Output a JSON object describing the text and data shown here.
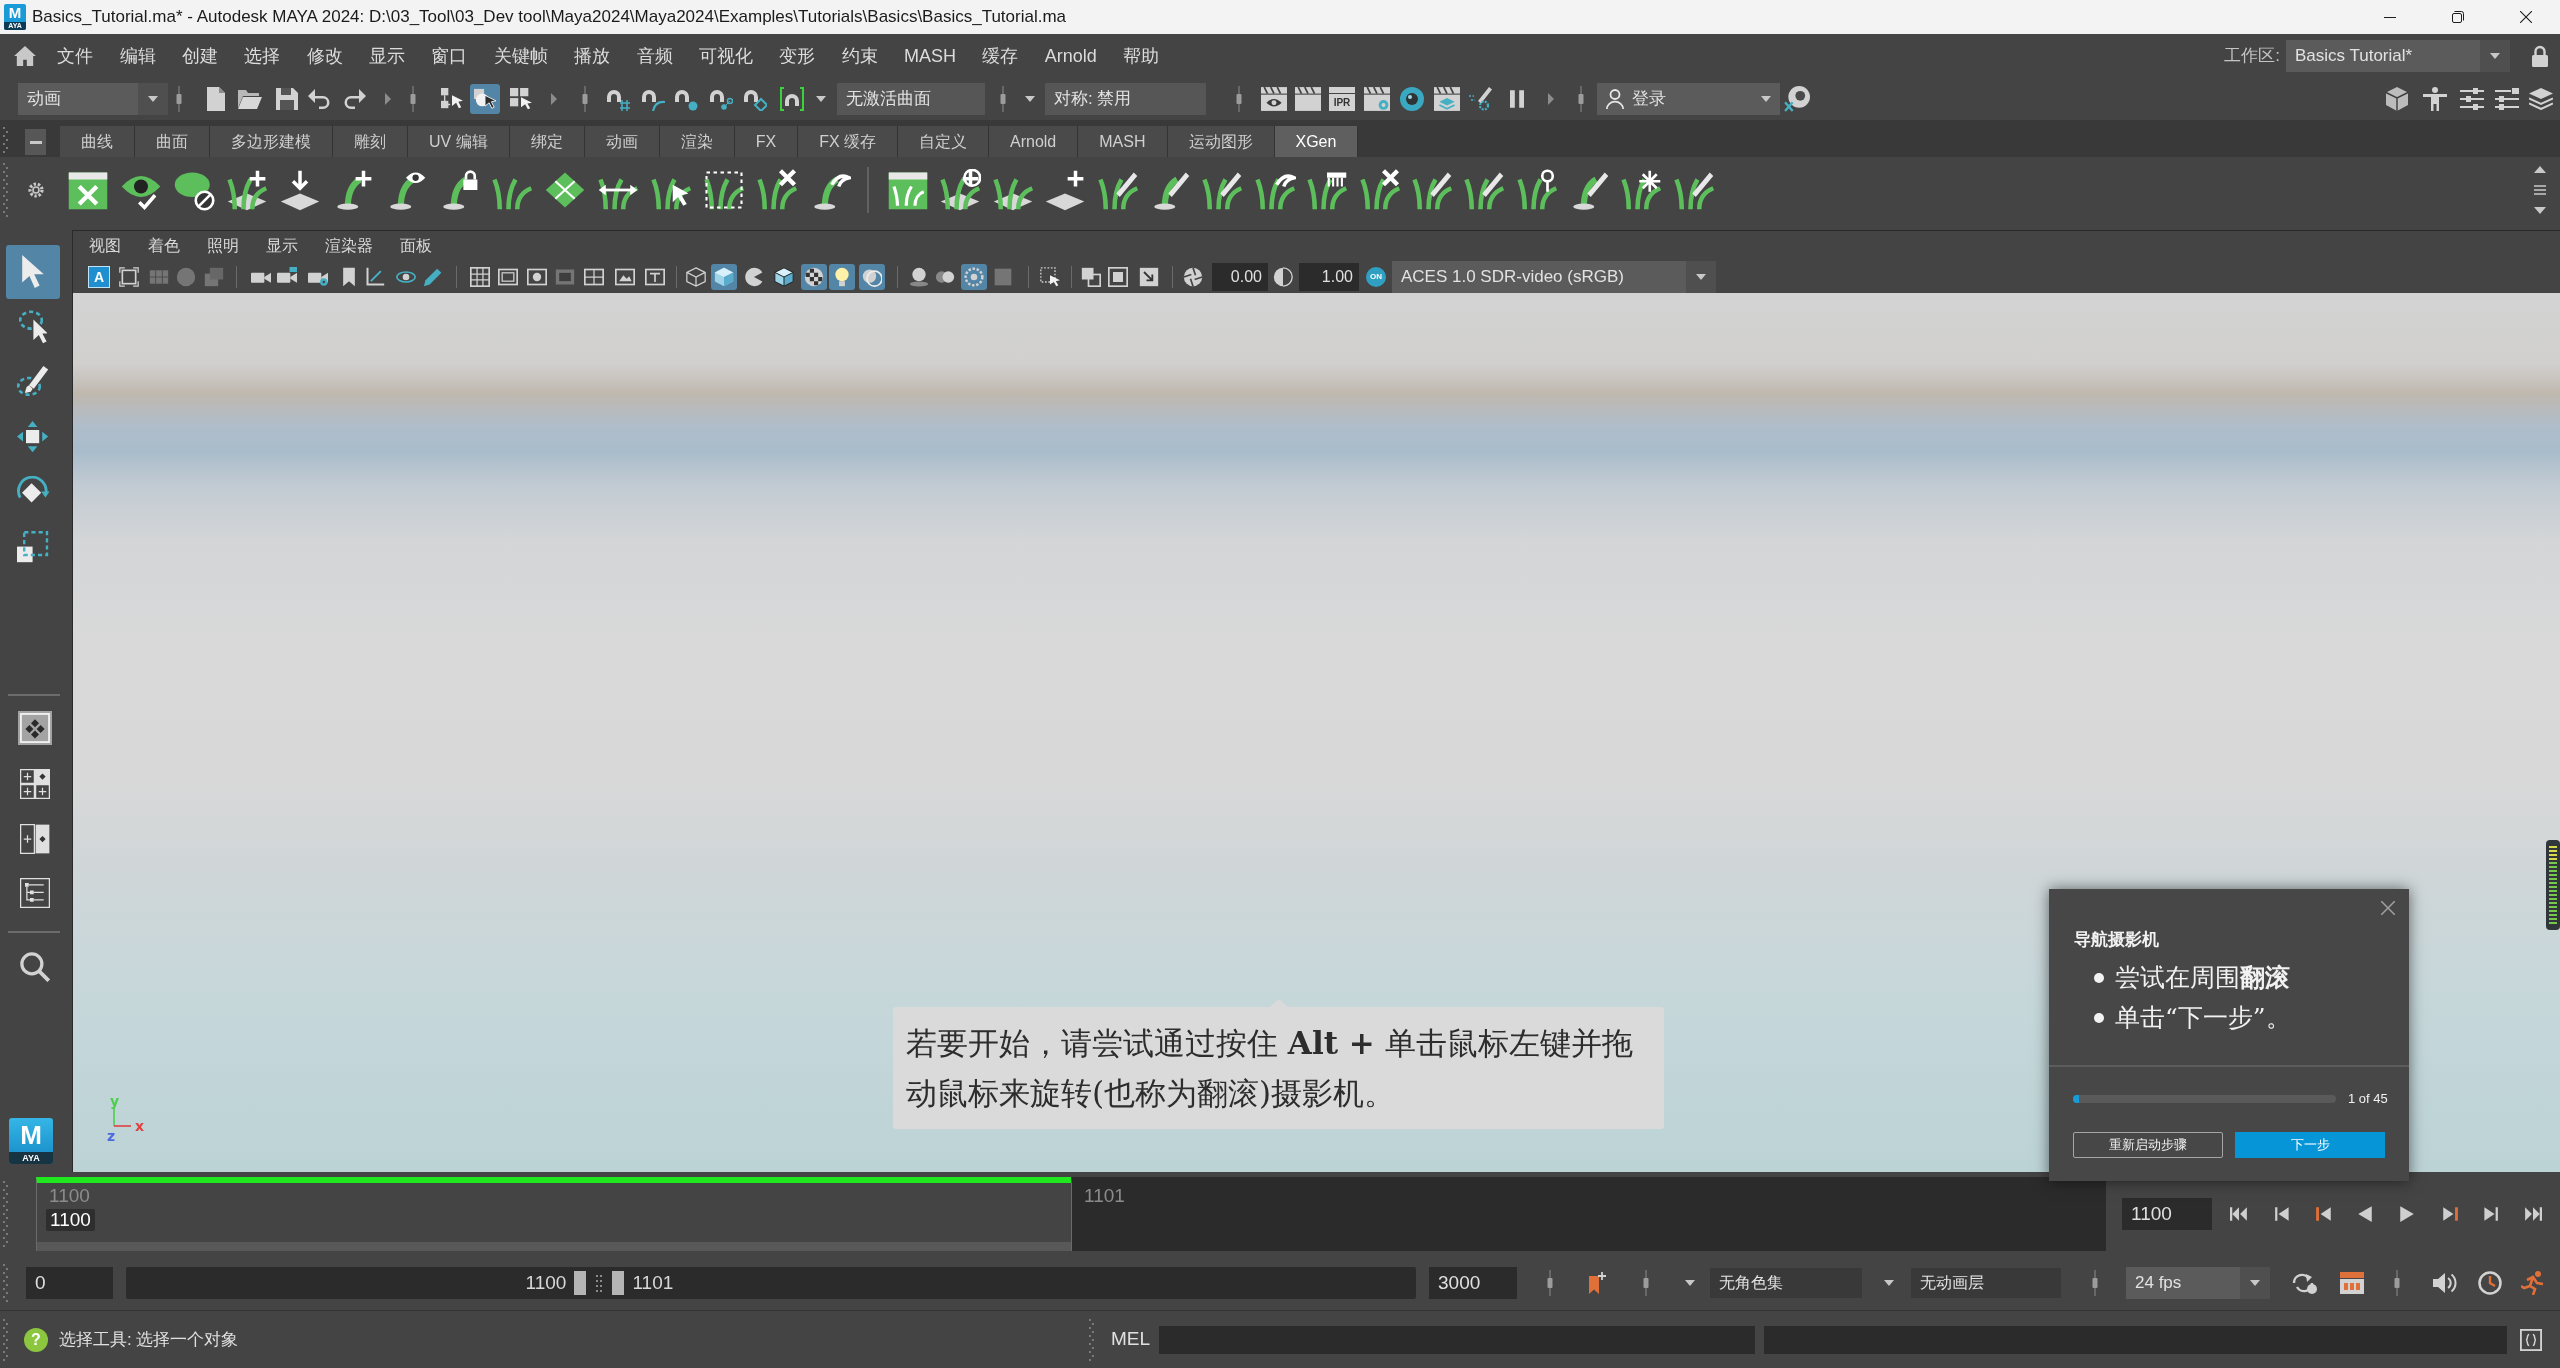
{
  "window": {
    "icon_letter": "M",
    "icon_caption": "AYA",
    "title": "Basics_Tutorial.ma* - Autodesk MAYA 2024: D:\\03_Tool\\03_Dev tool\\Maya2024\\Maya2024\\Examples\\Tutorials\\Basics\\Basics_Tutorial.ma"
  },
  "menu_bar": {
    "items": [
      "文件",
      "编辑",
      "创建",
      "选择",
      "修改",
      "显示",
      "窗口",
      "关键帧",
      "播放",
      "音频",
      "可视化",
      "变形",
      "约束",
      "MASH",
      "缓存",
      "Arnold",
      "帮助"
    ],
    "workspace_label": "工作区:",
    "workspace": "Basics Tutorial*"
  },
  "status_line": {
    "menu_set": "动画",
    "selection_modes": [
      {
        "selected": false
      },
      {
        "selected": true
      },
      {
        "selected": false
      }
    ],
    "live_surface": "无激活曲面",
    "symmetry": "对称: 禁用",
    "ipr_label": "IPR",
    "login": "登录"
  },
  "shelf": {
    "tabs": [
      {
        "label": "曲线",
        "selected": false
      },
      {
        "label": "曲面",
        "selected": false
      },
      {
        "label": "多边形建模",
        "selected": false
      },
      {
        "label": "雕刻",
        "selected": false
      },
      {
        "label": "UV 编辑",
        "selected": false
      },
      {
        "label": "绑定",
        "selected": false
      },
      {
        "label": "动画",
        "selected": false
      },
      {
        "label": "渲染",
        "selected": false
      },
      {
        "label": "FX",
        "selected": false
      },
      {
        "label": "FX 缓存",
        "selected": false
      },
      {
        "label": "自定义",
        "selected": false
      },
      {
        "label": "Arnold",
        "selected": false
      },
      {
        "label": "MASH",
        "selected": false
      },
      {
        "label": "运动图形",
        "selected": false
      },
      {
        "label": "XGen",
        "selected": true
      }
    ]
  },
  "toolbox": {
    "tools": [
      {
        "selected": true
      },
      {
        "selected": false
      },
      {
        "selected": false
      },
      {
        "selected": false
      },
      {
        "selected": false
      },
      {
        "selected": false
      }
    ],
    "layouts": [
      {
        "selected": true
      },
      {
        "selected": false
      },
      {
        "selected": false
      },
      {
        "selected": false
      }
    ],
    "logo_letter": "M",
    "logo_caption": "AYA"
  },
  "viewport_panel": {
    "menu": [
      "视图",
      "着色",
      "照明",
      "显示",
      "渲染器",
      "面板"
    ],
    "camera_letter": "A",
    "toggles": [
      {
        "on": true,
        "disabled": false
      },
      {
        "on": false,
        "disabled": false
      },
      {
        "on": false,
        "disabled": true
      },
      {
        "on": false,
        "disabled": true
      },
      {
        "on": false,
        "disabled": true
      },
      {
        "on": false,
        "disabled": false
      },
      {
        "on": false,
        "disabled": false
      },
      {
        "on": false,
        "disabled": false
      },
      {
        "on": false,
        "disabled": false
      },
      {
        "on": false,
        "disabled": false
      },
      {
        "on": false,
        "disabled": false
      },
      {
        "on": false,
        "disabled": false
      },
      {
        "on": false,
        "disabled": false
      },
      {
        "on": false,
        "disabled": false
      },
      {
        "on": false,
        "disabled": false
      },
      {
        "on": false,
        "disabled": true
      },
      {
        "on": false,
        "disabled": false
      },
      {
        "on": false,
        "disabled": false
      },
      {
        "on": false,
        "disabled": false
      },
      {
        "on": false,
        "disabled": false
      },
      {
        "on": true,
        "disabled": false
      },
      {
        "on": false,
        "disabled": false
      },
      {
        "on": false,
        "disabled": false
      },
      {
        "on": true,
        "disabled": false
      },
      {
        "on": true,
        "disabled": false
      },
      {
        "on": true,
        "disabled": false
      },
      {
        "on": false,
        "disabled": false
      },
      {
        "on": false,
        "disabled": false
      },
      {
        "on": true,
        "disabled": false
      },
      {
        "on": false,
        "disabled": true
      },
      {
        "on": false,
        "disabled": false
      },
      {
        "on": false,
        "disabled": false
      },
      {
        "on": false,
        "disabled": false
      },
      {
        "on": false,
        "disabled": false
      },
      {
        "on": false,
        "disabled": false
      },
      {
        "on": false,
        "disabled": false
      }
    ],
    "exposure": "0.00",
    "gamma": "1.00",
    "view_transform_badge": "ON",
    "view_transform": "ACES 1.0 SDR-video (sRGB)"
  },
  "viewport": {
    "hint": "若要开始，请尝试通过按住 **Alt +** 单击鼠标左键并拖动鼠标来旋转(也称为翻滚)摄影机。",
    "axes": [
      {
        "label": "y",
        "color": "#4ad04a"
      },
      {
        "label": "x",
        "color": "#e04040"
      },
      {
        "label": "z",
        "color": "#4a6ae0"
      }
    ]
  },
  "tutorial": {
    "title": "导航摄影机",
    "steps": [
      "尝试在周围**翻滚**",
      "单击“下一步”。"
    ],
    "level": 0.022,
    "progress": "1 of 45",
    "restart_button": "重新启动步骤",
    "next_button": "下一步"
  },
  "time_slider": {
    "frames": [
      {
        "label": "1100",
        "selected": true
      },
      {
        "label": "1101",
        "selected": false
      }
    ],
    "current_frame": "1100",
    "frame_field": "1100"
  },
  "range": {
    "start": "0",
    "range_start": "1100",
    "level": 0.367,
    "range_end": "1101",
    "end": "3000",
    "character_set": "无角色集",
    "anim_layer": "无动画层",
    "fps": "24 fps"
  },
  "command_line": {
    "help_glyph": "?",
    "message": "选择工具: 选择一个对象",
    "language": "MEL"
  }
}
